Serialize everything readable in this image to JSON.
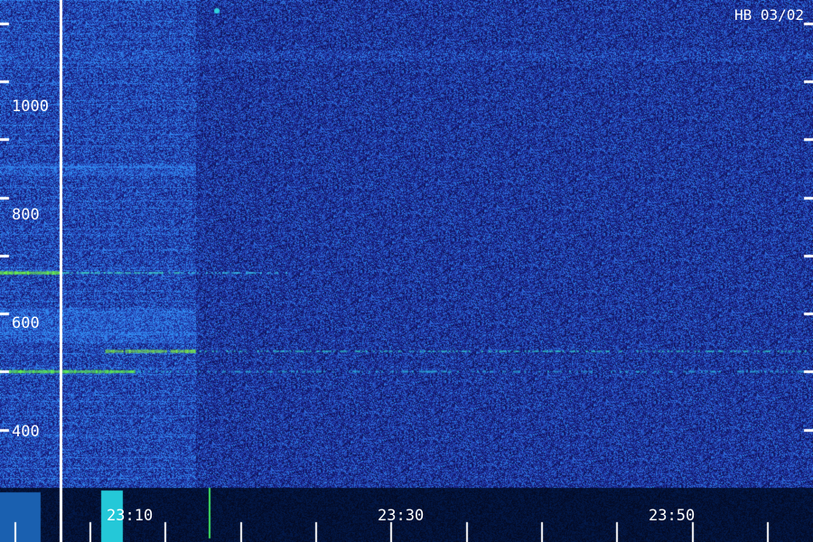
{
  "station_label": "HB 03/02",
  "chart_data": {
    "type": "heatmap",
    "title": "",
    "xlabel": "",
    "ylabel": "",
    "x_axis": {
      "kind": "time",
      "start": "23:06",
      "end": "24:00",
      "labeled_ticks": [
        "23:10",
        "23:30",
        "23:50"
      ],
      "minor_tick_step_minutes": 1
    },
    "y_axis": {
      "kind": "frequency",
      "range": [
        300,
        1140
      ],
      "labeled_ticks": [
        1000,
        800,
        600,
        400
      ],
      "minor_tick_step": 100
    },
    "background": "dense blue noise",
    "signals": [
      {
        "name": "",
        "frequency": 670,
        "time_start": "23:06",
        "time_end": "23:10",
        "color": "#6cf24a",
        "strength": 1.0
      },
      {
        "name": "",
        "frequency": 670,
        "time_start": "23:10",
        "time_end": "23:18",
        "color": "#3fd8c8",
        "strength": 0.7
      },
      {
        "name": "",
        "frequency": 670,
        "time_start": "23:18",
        "time_end": "23:25",
        "color": "#35b8e8",
        "strength": 0.5
      },
      {
        "name": "",
        "frequency": 535,
        "time_start": "23:13",
        "time_end": "23:19",
        "color": "#7ef04a",
        "strength": 0.9
      },
      {
        "name": "",
        "frequency": 535,
        "time_start": "23:19",
        "time_end": "24:00",
        "color": "#2fc0c8",
        "strength": 0.45
      },
      {
        "name": "",
        "frequency": 500,
        "time_start": "23:06",
        "time_end": "23:15",
        "color": "#5ef050",
        "strength": 1.0
      },
      {
        "name": "",
        "frequency": 500,
        "time_start": "23:15",
        "time_end": "24:00",
        "color": "#2aa8d8",
        "strength": 0.4
      }
    ],
    "events": [
      {
        "time": "23:10",
        "kind": "white vertical marker line"
      },
      {
        "time": "23:19",
        "kind": "change of background level"
      }
    ],
    "colors": {
      "noise_low": "#0a1470",
      "noise_mid": "#1e3cc8",
      "noise_high": "#2fa0e8",
      "marker": "#ffffff"
    }
  }
}
